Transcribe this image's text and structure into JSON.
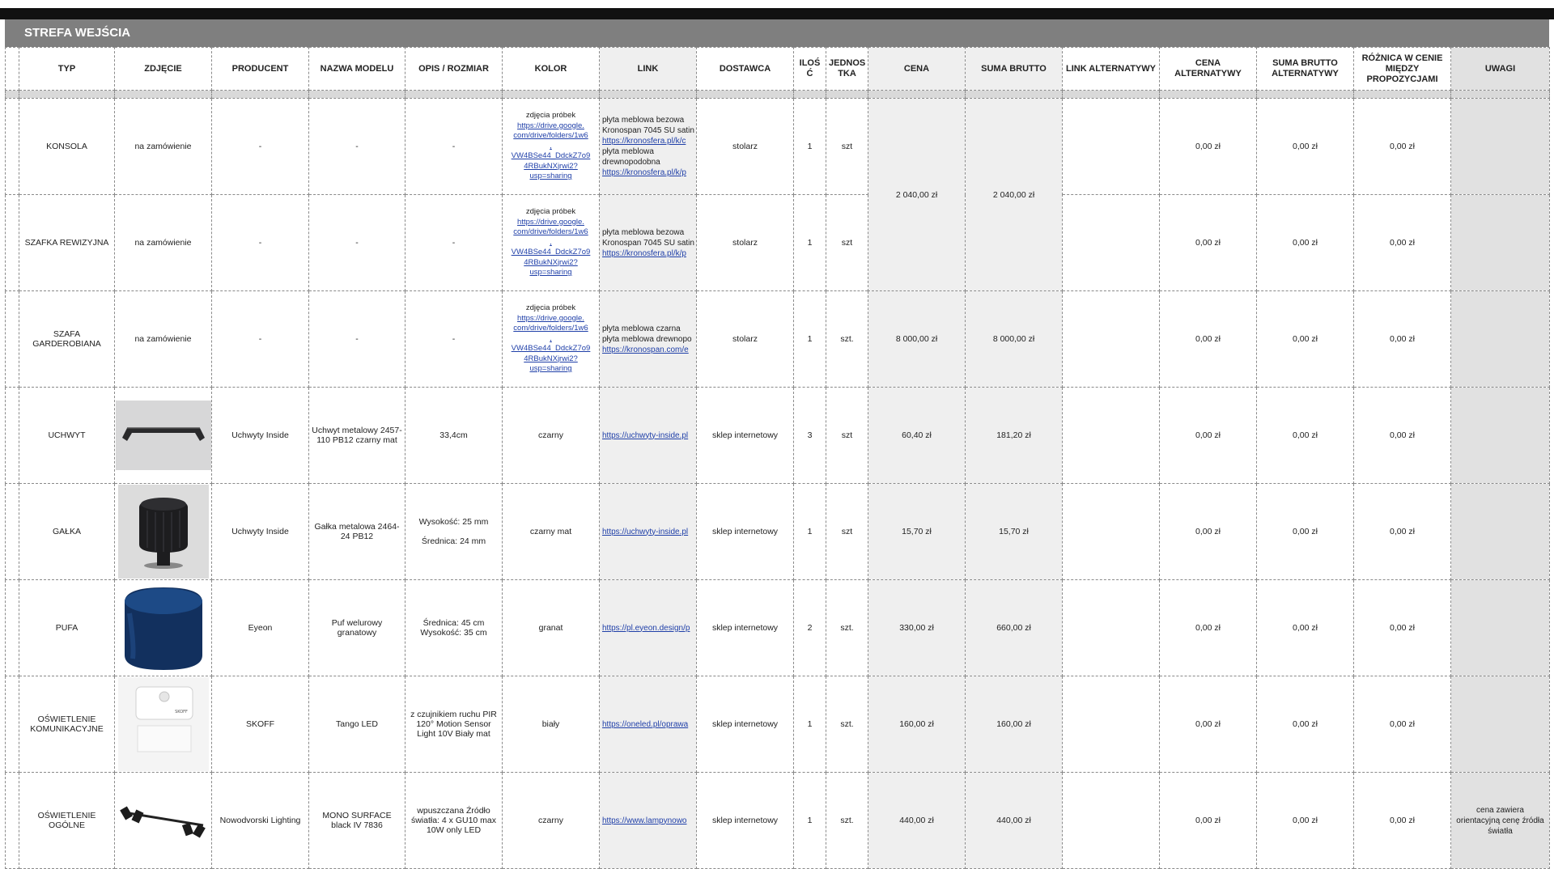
{
  "section_title": "STREFA WEJŚCIA",
  "headers": [
    "TYP",
    "ZDJĘCIE",
    "PRODUCENT",
    "NAZWA MODELU",
    "OPIS / ROZMIAR",
    "KOLOR",
    "LINK",
    "DOSTAWCA",
    "ILOŚ Ć",
    "JEDNOS TKA",
    "CENA",
    "SUMA BRUTTO",
    "LINK ALTERNATYWY",
    "CENA ALTERNATYWY",
    "SUMA BRUTTO ALTERNATYWY",
    "RÓŻNICA W CENIE MIĘDZY PROPOZYCJAMI",
    "UWAGI"
  ],
  "kolor_common": {
    "label": "zdjęcia próbek",
    "url_lines": [
      "https://drive.google.",
      "com/drive/folders/1w6",
      ",",
      "VW4BSe44_DdckZ7o9",
      "4RBukNXjrwi2?",
      "usp=sharing"
    ]
  },
  "merged_price": {
    "cena": "2 040,00 zł",
    "suma": "2 040,00 zł"
  },
  "rows": [
    {
      "typ": "KONSOLA",
      "zdjecie": "na zamówienie",
      "producent": "-",
      "model": "-",
      "opis": "-",
      "link_lines": [
        "płyta meblowa bezowa",
        "Kronospan 7045 SU satin",
        "https://kronosfera.pl/k/c",
        "płyta meblowa",
        "drewnopodobna",
        "https://kronosfera.pl/k/p"
      ],
      "dostawca": "stolarz",
      "ilosc": "1",
      "jednostka": "szt",
      "cena_alt": "0,00 zł",
      "suma_alt": "0,00 zł",
      "roznica": "0,00 zł",
      "uwagi": ""
    },
    {
      "typ": "SZAFKA REWIZYJNA",
      "zdjecie": "na zamówienie",
      "producent": "-",
      "model": "-",
      "opis": "-",
      "link_lines": [
        "płyta meblowa bezowa",
        "Kronospan 7045 SU satin",
        "https://kronosfera.pl/k/p"
      ],
      "dostawca": "stolarz",
      "ilosc": "1",
      "jednostka": "szt",
      "cena_alt": "0,00 zł",
      "suma_alt": "0,00 zł",
      "roznica": "0,00 zł",
      "uwagi": ""
    },
    {
      "typ": "SZAFA GARDEROBIANA",
      "zdjecie": "na zamówienie",
      "producent": "-",
      "model": "-",
      "opis": "-",
      "link_lines": [
        "płyta meblowa czarna",
        "płyta meblowa drewnopo",
        "https://kronospan.com/e"
      ],
      "dostawca": "stolarz",
      "ilosc": "1",
      "jednostka": "szt.",
      "cena": "8 000,00 zł",
      "suma": "8 000,00 zł",
      "cena_alt": "0,00 zł",
      "suma_alt": "0,00 zł",
      "roznica": "0,00 zł",
      "uwagi": ""
    },
    {
      "typ": "UCHWYT",
      "producent": "Uchwyty Inside",
      "model": "Uchwyt metalowy 2457-110 PB12 czarny mat",
      "opis": "33,4cm",
      "kolor": "czarny",
      "link": "https://uchwyty-inside.pl",
      "dostawca": "sklep internetowy",
      "ilosc": "3",
      "jednostka": "szt",
      "cena": "60,40 zł",
      "suma": "181,20 zł",
      "cena_alt": "0,00 zł",
      "suma_alt": "0,00 zł",
      "roznica": "0,00 zł",
      "uwagi": ""
    },
    {
      "typ": "GAŁKA",
      "producent": "Uchwyty Inside",
      "model": "Gałka metalowa 2464-24 PB12",
      "opis1": "Wysokość: 25 mm",
      "opis2": "Średnica: 24 mm",
      "kolor": "czarny mat",
      "link": "https://uchwyty-inside.pl",
      "dostawca": "sklep internetowy",
      "ilosc": "1",
      "jednostka": "szt",
      "cena": "15,70 zł",
      "suma": "15,70 zł",
      "cena_alt": "0,00 zł",
      "suma_alt": "0,00 zł",
      "roznica": "0,00 zł",
      "uwagi": ""
    },
    {
      "typ": "PUFA",
      "producent": "Eyeon",
      "model": "Puf welurowy granatowy",
      "opis1": "Średnica: 45 cm",
      "opis2": "Wysokość: 35 cm",
      "kolor": "granat",
      "link": "https://pl.eyeon.design/p",
      "dostawca": "sklep internetowy",
      "ilosc": "2",
      "jednostka": "szt.",
      "cena": "330,00 zł",
      "suma": "660,00 zł",
      "cena_alt": "0,00 zł",
      "suma_alt": "0,00 zł",
      "roznica": "0,00 zł",
      "uwagi": ""
    },
    {
      "typ": "OŚWIETLENIE KOMUNIKACYJNE",
      "producent": "SKOFF",
      "model": "Tango LED",
      "opis": "z czujnikiem ruchu PIR 120° Motion Sensor Light 10V Biały mat",
      "kolor": "biały",
      "link": "https://oneled.pl/oprawa",
      "dostawca": "sklep internetowy",
      "ilosc": "1",
      "jednostka": "szt.",
      "cena": "160,00 zł",
      "suma": "160,00 zł",
      "cena_alt": "0,00 zł",
      "suma_alt": "0,00 zł",
      "roznica": "0,00 zł",
      "uwagi": "",
      "photo_brand": "SKOFF"
    },
    {
      "typ": "OŚWIETLENIE OGÓLNE",
      "producent": "Nowodvorski Lighting",
      "model": "MONO SURFACE black IV 7836",
      "opis": "wpuszczana Źródło światła: 4 x GU10 max 10W only LED",
      "kolor": "czarny",
      "link": "https://www.lampynowo",
      "dostawca": "sklep internetowy",
      "ilosc": "1",
      "jednostka": "szt.",
      "cena": "440,00 zł",
      "suma": "440,00 zł",
      "cena_alt": "0,00 zł",
      "suma_alt": "0,00 zł",
      "roznica": "0,00 zł",
      "uwagi": "cena zawiera orientacyjną cenę źródła światła"
    }
  ]
}
